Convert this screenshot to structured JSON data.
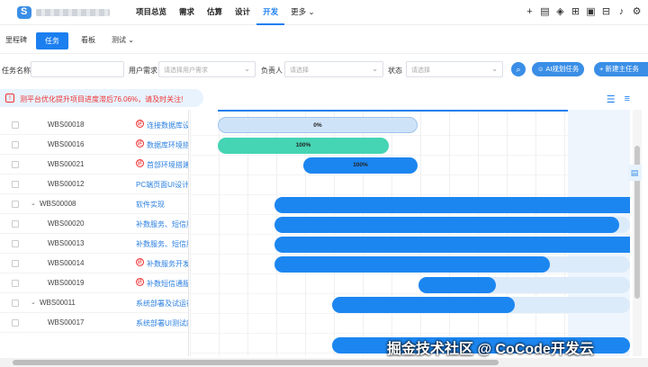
{
  "nav": {
    "items": [
      "项目总览",
      "需求",
      "估算",
      "设计",
      "开发",
      "更多"
    ],
    "active_index": 4
  },
  "top_icons": [
    "plus-icon",
    "document-icon",
    "layers-icon",
    "grid-icon",
    "folder-icon",
    "briefcase-icon",
    "bell-icon",
    "settings-icon"
  ],
  "subtabs": {
    "milestone": "里程碑",
    "task": "任务",
    "board": "看板",
    "test": "测试"
  },
  "filters": {
    "task_name_label": "任务名称",
    "user_req_label": "用户需求",
    "user_req_placeholder": "请选择用户需求",
    "owner_label": "负责人",
    "owner_placeholder": "请选择",
    "status_label": "状态",
    "status_placeholder": "请选择",
    "ai_button": "AI规划任务",
    "new_button": "+ 新建主任务"
  },
  "alert": {
    "text": "测平台优化提升项目进度滞后76.06%，请及时关注!"
  },
  "rows": [
    {
      "code": "WBS00018",
      "name": "连接数据库设",
      "risk": true,
      "indent": 2
    },
    {
      "code": "WBS00016",
      "name": "数据库环境搭",
      "risk": true,
      "indent": 2
    },
    {
      "code": "WBS00021",
      "name": "首部环境搭建",
      "risk": true,
      "indent": 2
    },
    {
      "code": "WBS00012",
      "name": "PC端页面UI设计",
      "risk": false,
      "indent": 2
    },
    {
      "code": "WBS00008",
      "name": "软件实现",
      "risk": false,
      "indent": 1
    },
    {
      "code": "WBS00020",
      "name": "补数服务、短信服",
      "risk": false,
      "indent": 2
    },
    {
      "code": "WBS00013",
      "name": "补数服务、短信服",
      "risk": false,
      "indent": 2
    },
    {
      "code": "WBS00014",
      "name": "补数服务开发",
      "risk": true,
      "indent": 2
    },
    {
      "code": "WBS00019",
      "name": "补数短信通服",
      "risk": true,
      "indent": 2
    },
    {
      "code": "WBS00011",
      "name": "系统部署及试运行",
      "risk": false,
      "indent": 1
    },
    {
      "code": "WBS00017",
      "name": "系统部署UI测试的",
      "risk": false,
      "indent": 2
    }
  ],
  "risk_mark": "延",
  "bars": [
    {
      "progress_label": "0%",
      "progress": 0,
      "style": "light"
    },
    {
      "progress_label": "100%",
      "progress": 100,
      "style": "green"
    },
    {
      "progress_label": "100%",
      "progress": 100,
      "style": "blue"
    }
  ],
  "watermark": "掘金技术社区 @ CoCode开发云"
}
